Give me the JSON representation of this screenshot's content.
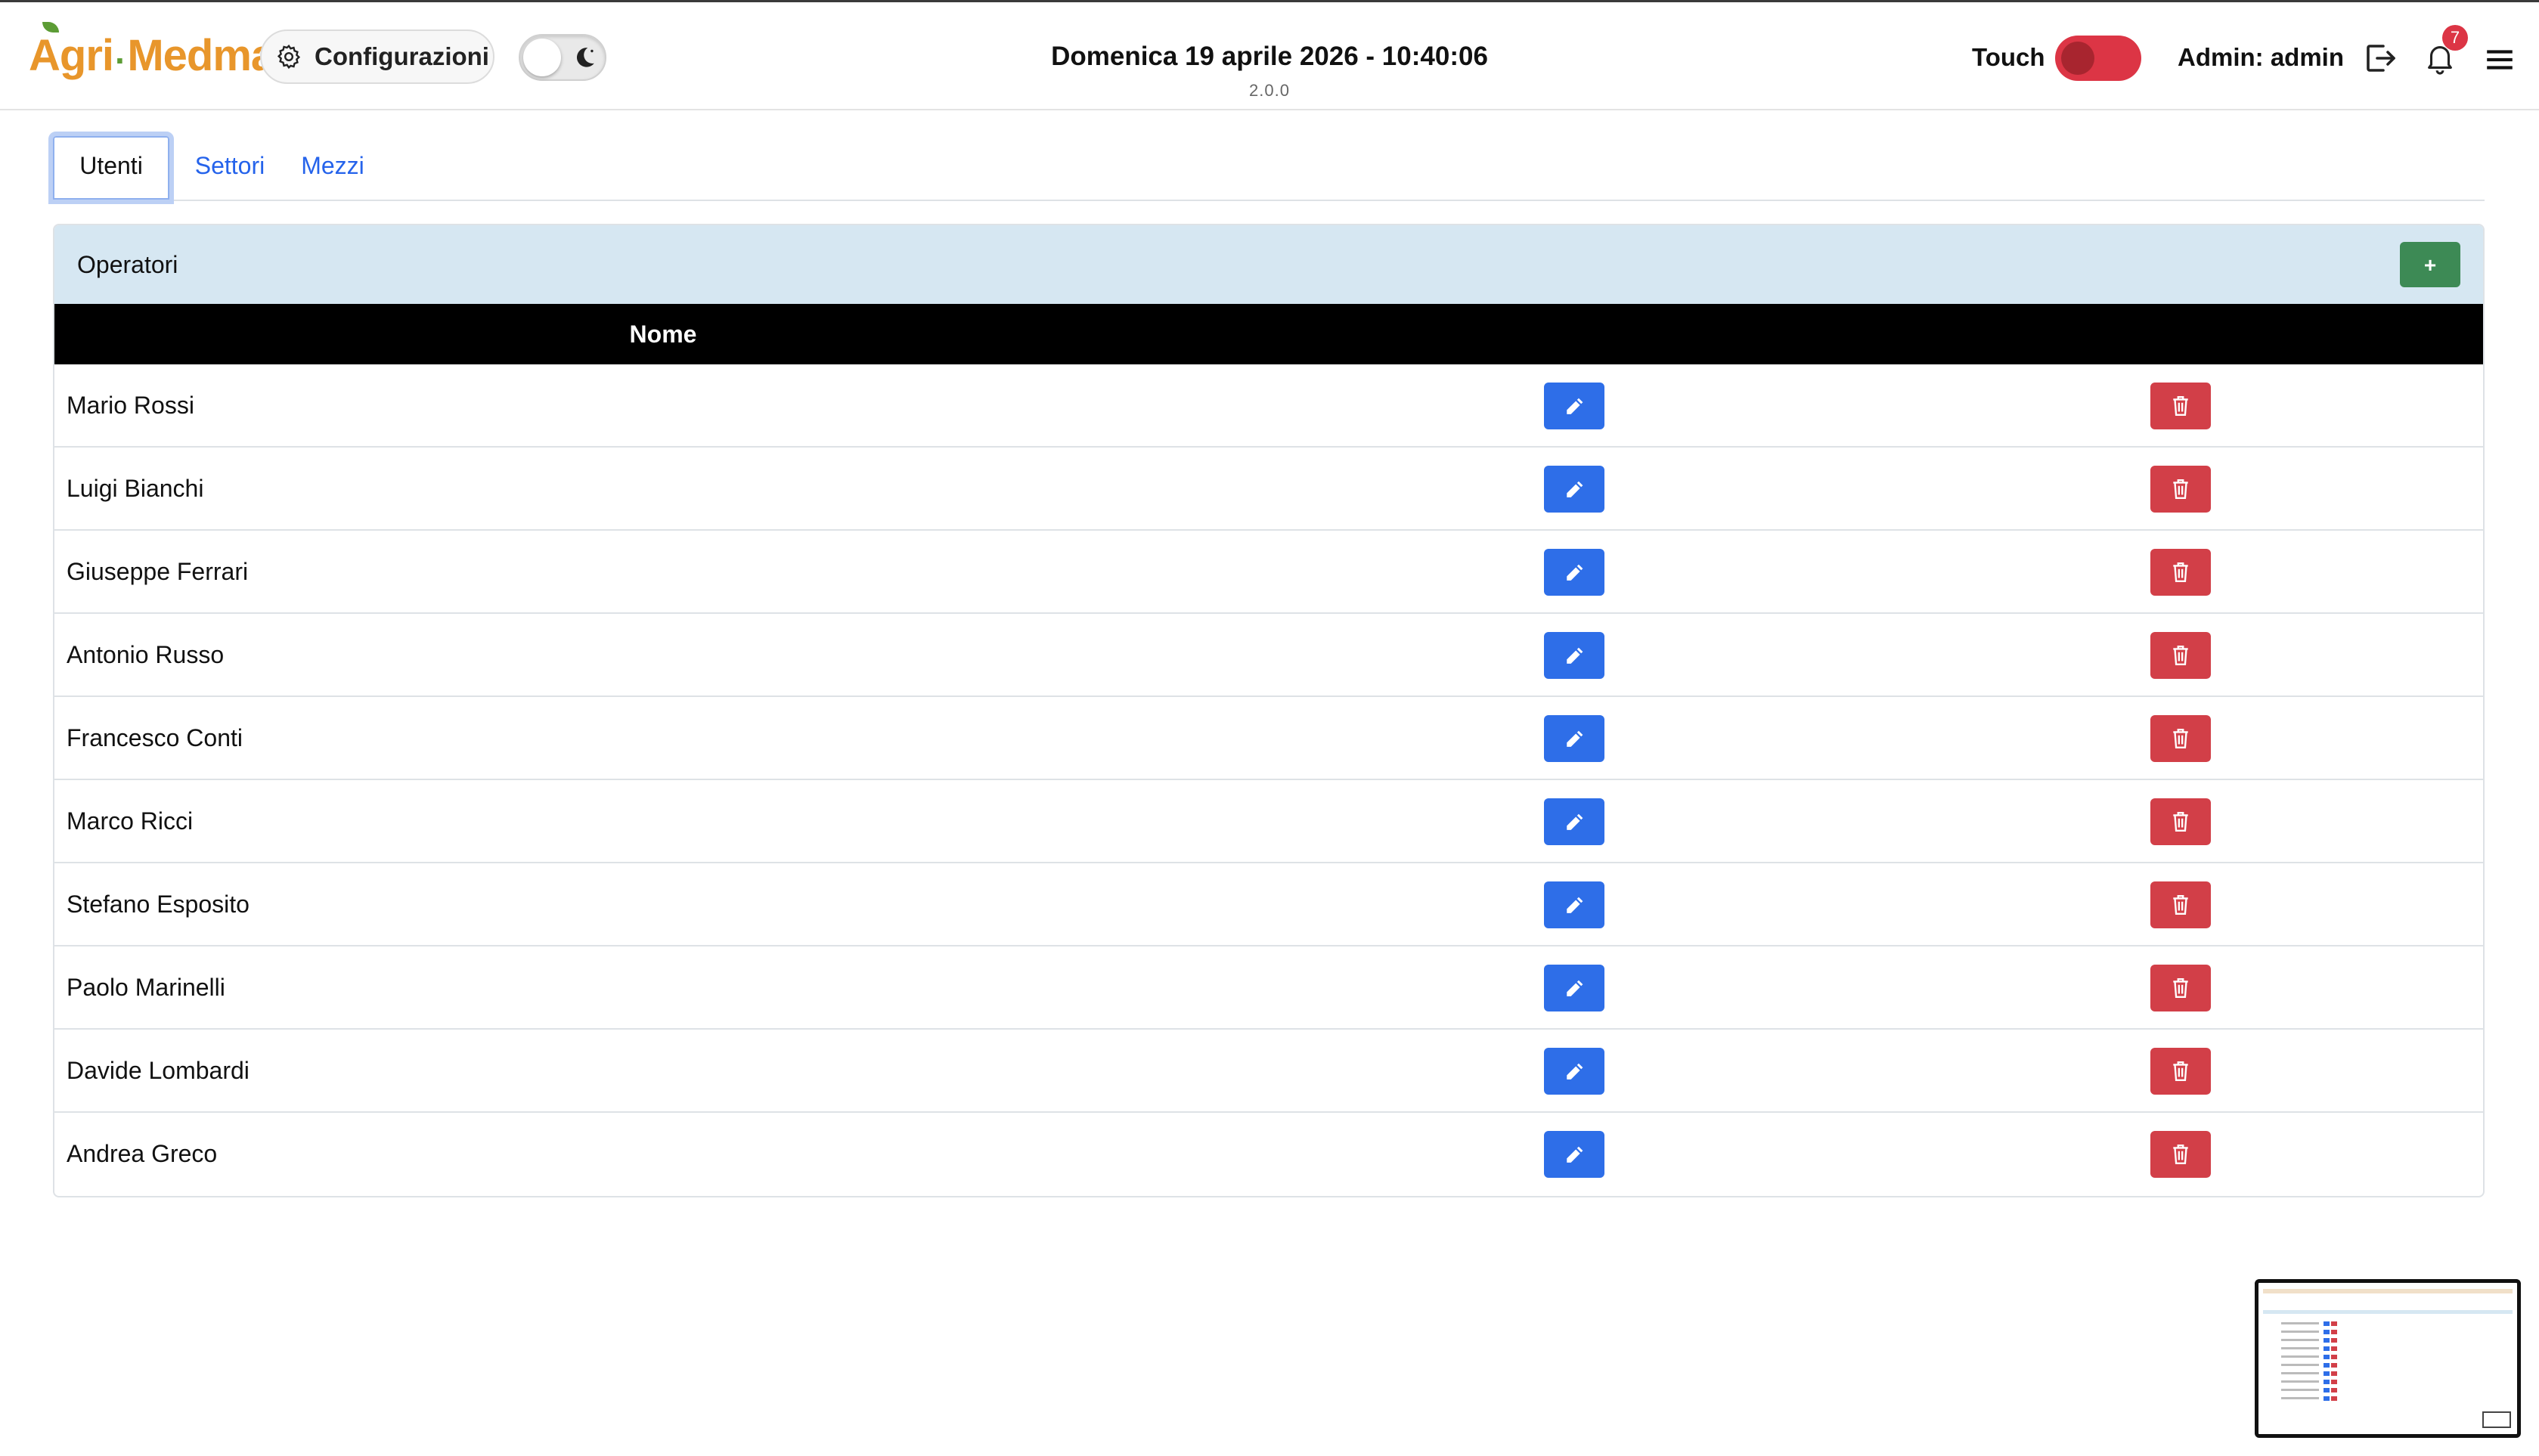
{
  "header": {
    "logo_text_1": "Agri",
    "logo_dot": "·",
    "logo_text_2": "Medma",
    "config_label": "Configurazioni",
    "datetime": "Domenica 19 aprile 2026 - 10:40:06",
    "version": "2.0.0",
    "touch_label": "Touch",
    "admin_label": "Admin: admin",
    "notifications_count": "7",
    "theme_toggle_on": false,
    "touch_toggle_on": true
  },
  "tabs": [
    {
      "label": "Utenti",
      "active": true
    },
    {
      "label": "Settori",
      "active": false
    },
    {
      "label": "Mezzi",
      "active": false
    }
  ],
  "card": {
    "title": "Operatori",
    "add_label": "+",
    "column_name": "Nome",
    "rows": [
      {
        "name": "Mario Rossi"
      },
      {
        "name": "Luigi Bianchi"
      },
      {
        "name": "Giuseppe Ferrari"
      },
      {
        "name": "Antonio Russo"
      },
      {
        "name": "Francesco Conti"
      },
      {
        "name": "Marco Ricci"
      },
      {
        "name": "Stefano Esposito"
      },
      {
        "name": "Paolo Marinelli"
      },
      {
        "name": "Davide Lombardi"
      },
      {
        "name": "Andrea Greco"
      }
    ]
  },
  "colors": {
    "brand_orange": "#e8962b",
    "brand_green": "#5c9c35",
    "edit_blue": "#2e6ee8",
    "delete_red": "#d23f48",
    "add_green": "#3d8a55",
    "card_header": "#d6e7f2",
    "touch_on": "#dc3545"
  },
  "icons": {
    "config": "gear-icon",
    "theme": "moon-icon",
    "logout": "logout-icon",
    "notifications": "bell-icon",
    "menu": "hamburger-icon",
    "edit": "pencil-icon",
    "delete": "trash-icon"
  }
}
